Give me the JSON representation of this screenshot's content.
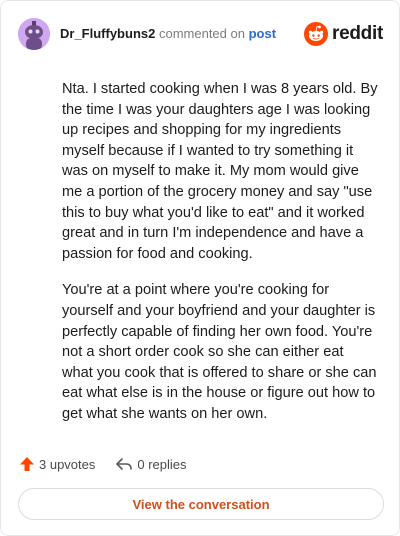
{
  "comment": {
    "username": "Dr_Fluffybuns2",
    "action_text": "commented on",
    "post_link": "post",
    "paragraphs": [
      "Nta. I started cooking when I was 8 years old. By the time I was your daughters age I was looking up recipes and shopping for my ingredients myself because if I wanted to try something it was on myself to make it. My mom would give me a portion of the grocery money and say \"use this to buy what you'd like to eat\" and it worked great and in turn I'm independence and have a passion for food and cooking.",
      "You're at a point where you're cooking for yourself and your boyfriend and your daughter is perfectly capable of finding her own food. You're not a short order cook so she can either eat what you cook that is offered to share or she can eat what else is in the house or figure out how to get what she wants on her own."
    ]
  },
  "brand": {
    "name": "reddit",
    "color": "#ff4500"
  },
  "stats": {
    "upvotes": "3 upvotes",
    "replies": "0 replies"
  },
  "cta": {
    "label": "View the conversation",
    "color": "#d1501b"
  }
}
